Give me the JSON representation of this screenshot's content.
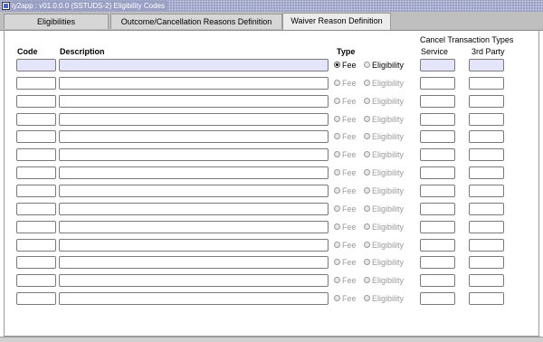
{
  "window": {
    "title": "iy2app : v01.0.0.0 (SSTUDS-2) Eligibility Codes"
  },
  "tabs": [
    {
      "label": "Eligibilities"
    },
    {
      "label": "Outcome/Cancellation Reasons Definition"
    },
    {
      "label": "Waiver Reason Definition",
      "active": true
    }
  ],
  "headers": {
    "code": "Code",
    "description": "Description",
    "type": "Type",
    "cancel_group": "Cancel Transaction Types",
    "service": "Service",
    "third_party": "3rd Party"
  },
  "radio_options": {
    "fee": "Fee",
    "eligibility": "Eligibility"
  },
  "rows": [
    {
      "code": "",
      "description": "",
      "type": "Fee",
      "service": "",
      "third_party": "",
      "active": true
    },
    {
      "code": "",
      "description": "",
      "type": "",
      "service": "",
      "third_party": ""
    },
    {
      "code": "",
      "description": "",
      "type": "",
      "service": "",
      "third_party": ""
    },
    {
      "code": "",
      "description": "",
      "type": "",
      "service": "",
      "third_party": ""
    },
    {
      "code": "",
      "description": "",
      "type": "",
      "service": "",
      "third_party": ""
    },
    {
      "code": "",
      "description": "",
      "type": "",
      "service": "",
      "third_party": ""
    },
    {
      "code": "",
      "description": "",
      "type": "",
      "service": "",
      "third_party": ""
    },
    {
      "code": "",
      "description": "",
      "type": "",
      "service": "",
      "third_party": ""
    },
    {
      "code": "",
      "description": "",
      "type": "",
      "service": "",
      "third_party": ""
    },
    {
      "code": "",
      "description": "",
      "type": "",
      "service": "",
      "third_party": ""
    },
    {
      "code": "",
      "description": "",
      "type": "",
      "service": "",
      "third_party": ""
    },
    {
      "code": "",
      "description": "",
      "type": "",
      "service": "",
      "third_party": ""
    },
    {
      "code": "",
      "description": "",
      "type": "",
      "service": "",
      "third_party": ""
    },
    {
      "code": "",
      "description": "",
      "type": "",
      "service": "",
      "third_party": ""
    }
  ],
  "colors": {
    "selected_field": "#e4e4fa",
    "titlebar": "#9aa0c4"
  }
}
